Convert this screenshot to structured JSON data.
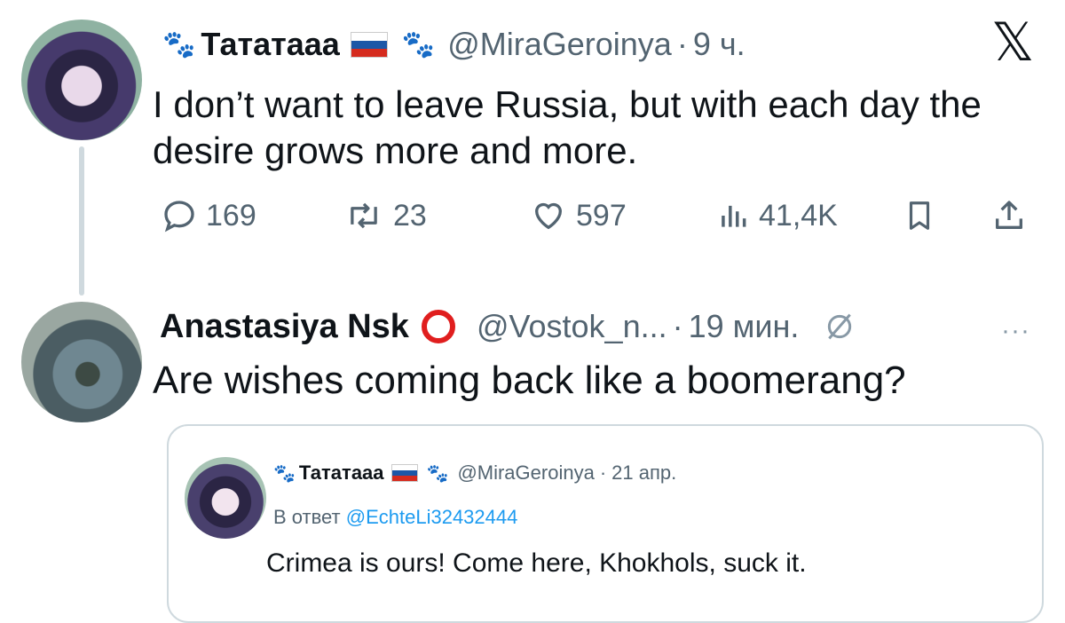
{
  "tweet": {
    "author_name": "Тататааа",
    "handle": "@MiraGeroinya",
    "separator": "·",
    "time": "9 ч.",
    "text": "I don’t want to leave Russia, but with each day the desire grows more and more.",
    "replies": "169",
    "reposts": "23",
    "likes": "597",
    "views": "41,4K"
  },
  "reply_tweet": {
    "author_name": "Anastasiya Nsk",
    "handle": "@Vostok_n...",
    "separator": "·",
    "time": "19 мин.",
    "more": "···",
    "text": "Are wishes coming back like a boomerang?"
  },
  "quoted_tweet": {
    "author_name": "Тататааа",
    "handle": "@MiraGeroinya",
    "separator": "·",
    "time": "21 апр.",
    "reply_prefix": "В ответ",
    "reply_to": "@EchteLi32432444",
    "text": "Crimea is ours! Come here, Khokhols, suck it."
  },
  "platform_logo": "𝕏",
  "icons": [
    "paw-icon",
    "russia-flag-icon",
    "x-logo-icon",
    "reply-icon",
    "repost-icon",
    "like-icon",
    "views-icon",
    "bookmark-icon",
    "share-icon",
    "red-circle-icon",
    "slashed-circle-icon",
    "more-icon"
  ],
  "colors": {
    "text": "#0f1419",
    "muted": "#536471",
    "link": "#1d9bf0",
    "border": "#cfd9de",
    "ring": "#e01e1e"
  }
}
